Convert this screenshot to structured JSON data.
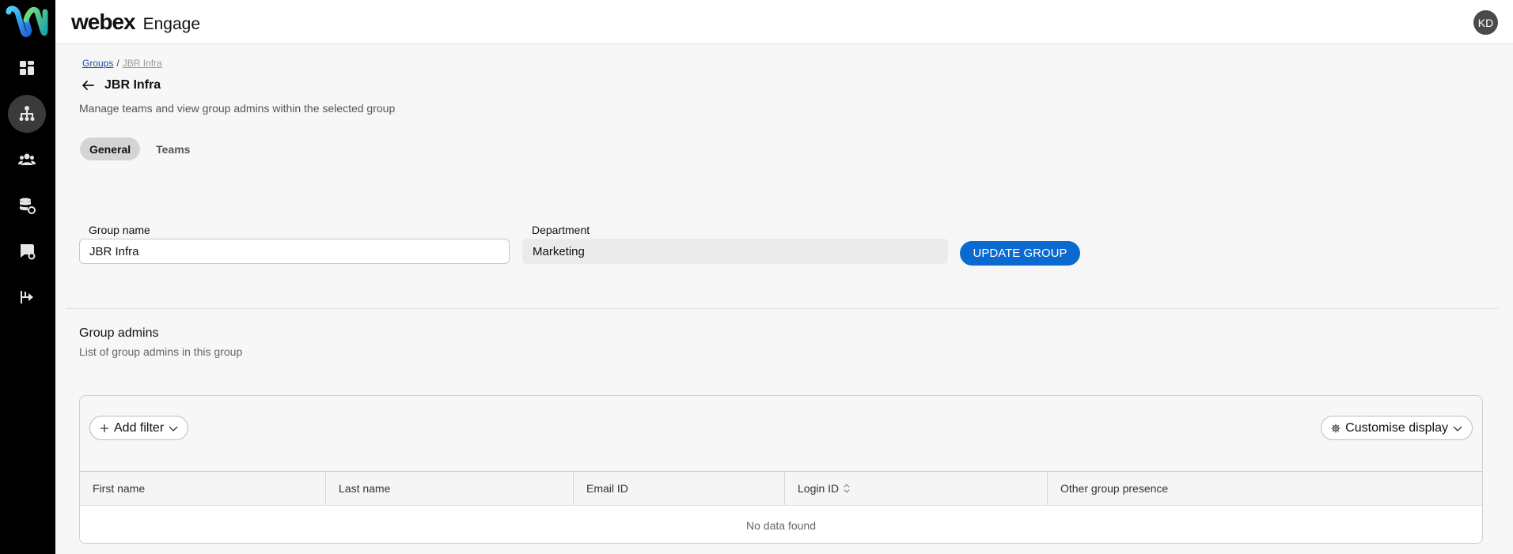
{
  "header": {
    "brand_name": "webex",
    "product_name": "Engage",
    "avatar_initials": "KD"
  },
  "rail": {
    "items": [
      {
        "icon": "dashboard-icon",
        "active": false
      },
      {
        "icon": "groups-hierarchy-icon",
        "active": true
      },
      {
        "icon": "users-icon",
        "active": false
      },
      {
        "icon": "database-settings-icon",
        "active": false
      },
      {
        "icon": "chat-settings-icon",
        "active": false
      },
      {
        "icon": "routing-icon",
        "active": false
      }
    ]
  },
  "breadcrumb": {
    "parent": "Groups",
    "separator": "/",
    "current": "JBR Infra"
  },
  "page": {
    "title": "JBR Infra",
    "subtitle": "Manage teams and view group admins within the selected group"
  },
  "tabs": [
    {
      "label": "General",
      "active": true
    },
    {
      "label": "Teams",
      "active": false
    }
  ],
  "form": {
    "group_name_label": "Group name",
    "group_name_value": "JBR Infra",
    "department_label": "Department",
    "department_value": "Marketing",
    "update_button": "UPDATE GROUP"
  },
  "admins": {
    "title": "Group admins",
    "subtitle": "List of group admins in this group",
    "add_filter": "Add filter",
    "customise_display": "Customise display",
    "columns": [
      "First name",
      "Last name",
      "Email ID",
      "Login ID",
      "Other group presence"
    ],
    "empty_message": "No data found"
  },
  "colors": {
    "accent": "#0b6acf",
    "rail_bg": "#000000",
    "page_bg": "#f7f7f7"
  }
}
